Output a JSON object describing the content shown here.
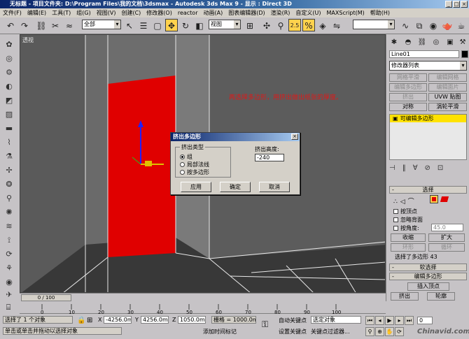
{
  "window": {
    "title": "无标题   - 项目文件夹: D:\\Program Files\\我的文档\\3dsmax    - Autodesk 3ds Max 9    - 显示 : Direct 3D",
    "min": "_",
    "max": "□",
    "close": "×"
  },
  "menu": [
    "文件(F)",
    "编辑(E)",
    "工具(T)",
    "组(G)",
    "视图(V)",
    "创建(C)",
    "修改器(O)",
    "reactor",
    "动画(A)",
    "图表编辑器(D)",
    "渲染(R)",
    "自定义(U)",
    "MAXScript(M)",
    "帮助(H)"
  ],
  "toolbar": {
    "selection_filter": "全部",
    "ref_coord": "视图",
    "snap_value": "2.5",
    "named_sel": ""
  },
  "viewport": {
    "label": "透视",
    "annotation": "再选择多边形，用挤出做出纸张的厚度。",
    "colors": {
      "bg": "#6b6b6b",
      "paper": "#e00000",
      "wall": "#5e5e5e",
      "floor": "#3a3a3a",
      "line": "#e8e8e8"
    }
  },
  "dialog": {
    "title": "挤出多边形",
    "close": "×",
    "group_title": "挤出类型",
    "radio_group": "组",
    "radio_local": "局部法线",
    "radio_poly": "按多边形",
    "height_label": "挤出高度:",
    "height_value": "-240",
    "apply": "应用",
    "ok": "确定",
    "cancel": "取消"
  },
  "panel": {
    "object_name": "Line01",
    "modifier_list": "修改器列表",
    "btn_edit_poly": "网格平滑",
    "btn_edit_mesh": "编辑网格",
    "btn_row2a": "编辑多边形",
    "btn_row2b": "编辑面片",
    "btn_extrude": "挤出",
    "btn_uvw": "UVW 贴图",
    "btn_symmetry": "对称",
    "btn_turbo": "涡轮平滑",
    "stack_item": "可编辑多边形",
    "sel_title": "选择",
    "by_vertex": "按顶点",
    "ignore_back": "忽略背面",
    "angle_label": "按角度:",
    "angle_value": "45.0",
    "shrink": "收缩",
    "grow": "扩大",
    "ring": "环形",
    "loop": "循环",
    "sel_status": "选择了多边形 43",
    "soft_sel": "软选择",
    "edit_poly_title": "编辑多边形",
    "insert_vertex": "插入顶点",
    "extrude": "挤出",
    "outline": "轮廓",
    "bevel": "倒角",
    "inset": "插入"
  },
  "timeline": {
    "frame": "0 / 100",
    "ticks": [
      "0",
      "10",
      "20",
      "30",
      "40",
      "50",
      "60",
      "70",
      "80",
      "90",
      "100"
    ]
  },
  "status": {
    "selected": "选择了 1 个对象",
    "prompt": "单击或单击并拖动以选择对象",
    "x_label": "X",
    "x_value": "-4256.0mm",
    "y_label": "Y",
    "y_value": "4256.0mm",
    "z_label": "Z",
    "z_value": "1050.0mm",
    "grid": "栅格 = 1000.0mm",
    "auto_key": "自动关键点",
    "set_key": "设置关键点",
    "sel_filter": "选定对象",
    "key_filter": "关键点过滤器...",
    "add_tag": "添加时间标记",
    "frame_value": "0",
    "watermark": "Chinavid.com"
  }
}
